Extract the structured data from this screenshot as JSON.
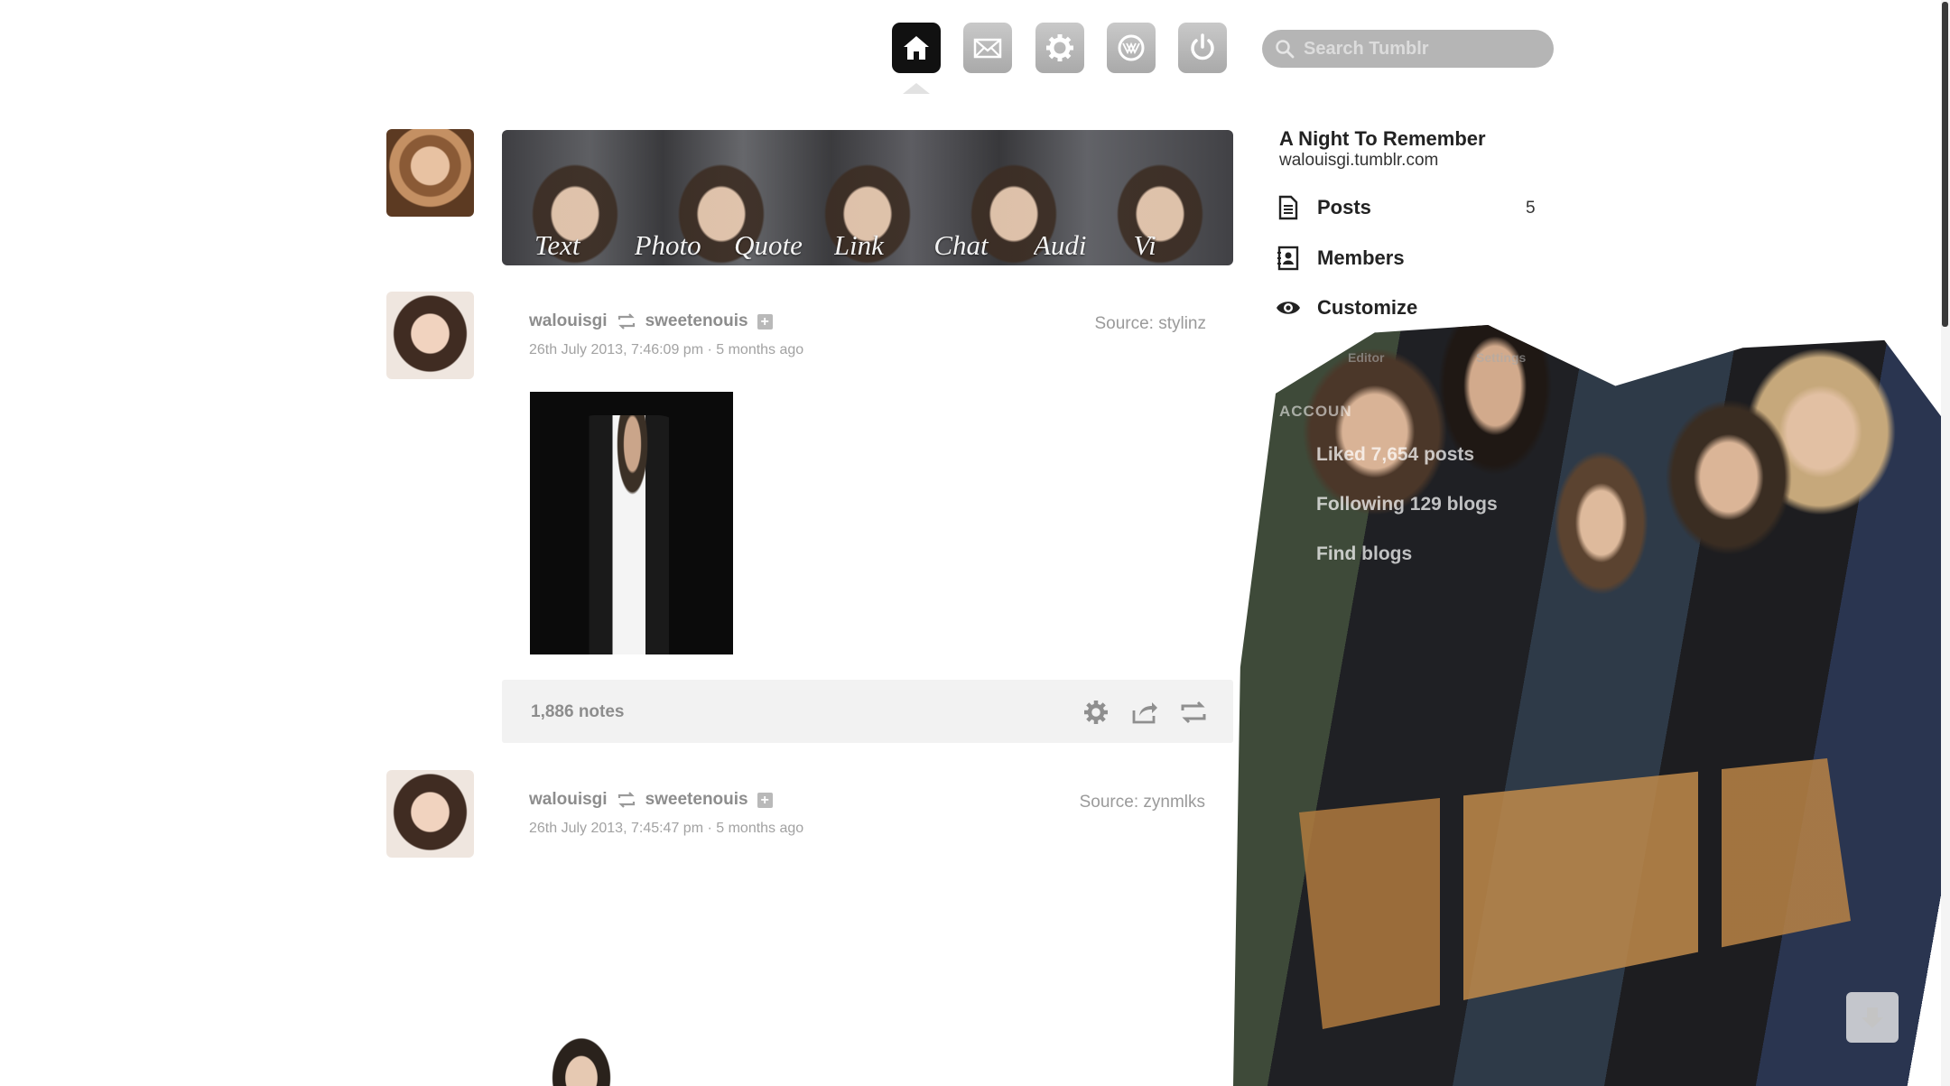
{
  "nav": {
    "items": [
      {
        "id": "home",
        "icon": "home-icon",
        "active": true
      },
      {
        "id": "inbox",
        "icon": "mail-icon",
        "active": false
      },
      {
        "id": "settings",
        "icon": "gear-icon",
        "active": false
      },
      {
        "id": "activity",
        "icon": "activity-icon",
        "active": false
      },
      {
        "id": "logout",
        "icon": "power-icon",
        "active": false
      }
    ],
    "search_placeholder": "Search Tumblr"
  },
  "post_types": [
    "Text",
    "Photo",
    "Quote",
    "Link",
    "Chat",
    "Audi",
    "Vi"
  ],
  "posts": [
    {
      "author": "walouisgi",
      "reblogged_from": "sweetenouis",
      "date": "26th July 2013, 7:46:09 pm · 5 months ago",
      "source": "Source: stylinz",
      "notes": "1,886 notes"
    },
    {
      "author": "walouisgi",
      "reblogged_from": "sweetenouis",
      "date": "26th July 2013, 7:45:47 pm · 5 months ago",
      "source": "Source: zynmlks"
    }
  ],
  "sidebar": {
    "blog_title": "A Night To Remember",
    "blog_url": "walouisgi.tumblr.com",
    "items": [
      {
        "label": "Posts",
        "count": "5",
        "icon": "document-icon"
      },
      {
        "label": "Members",
        "icon": "members-icon"
      },
      {
        "label": "Customize",
        "icon": "eye-icon"
      }
    ],
    "faded": {
      "editor": "Editor",
      "settings": "Settings",
      "account": "ACCOUN",
      "liked": "Liked 7,654 posts",
      "following": "Following 129 blogs",
      "find": "Find blogs"
    }
  },
  "colors": {
    "active_nav": "#111111",
    "nav_button": "#b0b0b0",
    "search_bg": "#b5b5b5",
    "muted_text": "#8d8d8d",
    "notes_bar": "#f2f2f2"
  }
}
